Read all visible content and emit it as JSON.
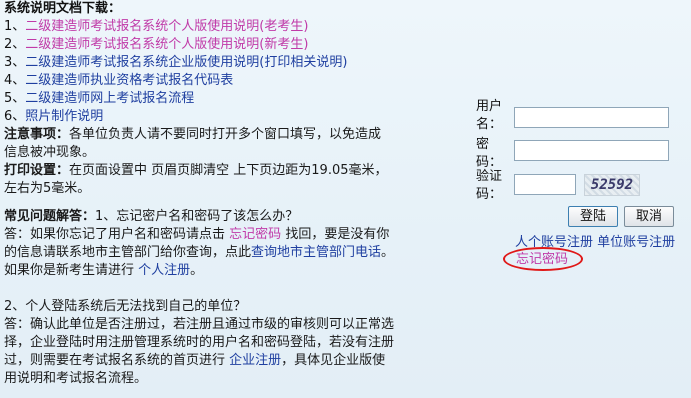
{
  "docs": {
    "heading": "系统说明文档下载：",
    "items": [
      {
        "num": "1、",
        "label": "二级建造师考试报名系统个人版使用说明(老考生)"
      },
      {
        "num": "2、",
        "label": "二级建造师考试报名系统个人版使用说明(新考生)"
      },
      {
        "num": "3、",
        "label": "二级建造师考试报名系统企业版使用说明(打印相关说明)"
      },
      {
        "num": "4、",
        "label": "二级建造师执业资格考试报名代码表"
      },
      {
        "num": "5、",
        "label": "二级建造师网上考试报名流程"
      },
      {
        "num": "6、",
        "label": "照片制作说明"
      }
    ]
  },
  "notice": {
    "title": "注意事项：",
    "text1": "各单位负责人请不要同时打开多个窗口填写，以免造成",
    "text2": "信息被冲现象。"
  },
  "print": {
    "title": "打印设置：",
    "text1": "在页面设置中 页眉页脚清空 上下页边距为19.05毫米，",
    "text2": "左右为5毫米。"
  },
  "faq": {
    "title": "常见问题解答：",
    "q1": "1、忘记密户名和密码了该怎么办？",
    "a1_prefix": "答：如果你忘记了用户名和密码请点击",
    "a1_link": "忘记密码",
    "a1_mid": "找回，要是没有你",
    "a1_line2_prefix": "的信息请联系地市主管部门给你查询，点此",
    "a1_link2": "查询地市主管部门电话",
    "a1_line2_end": "。",
    "a1_line3_prefix": "如果你是新考生请进行",
    "a1_link3": "个人注册",
    "a1_line3_end": "。",
    "q2": "2、个人登陆系统后无法找到自己的单位？",
    "a2_line1": "答：确认此单位是否注册过，若注册且通过市级的审核则可以正常选",
    "a2_line2": "择，企业登陆时用注册管理系统时的用户名和密码登陆，若没有注册",
    "a2_line3_prefix": "过，则需要在考试报名系统的首页进行",
    "a2_link": "企业注册",
    "a2_line3_end": "，具体见企业版使",
    "a2_line4": "用说明和考试报名流程。"
  },
  "login": {
    "username_label_1": "用户",
    "username_label_2": "名：",
    "username_value": "",
    "password_label_1": "密",
    "password_label_2": "码：",
    "password_value": "",
    "captcha_label_1": "验证",
    "captcha_label_2": "码：",
    "captcha_value": "",
    "captcha_image_text": "52592",
    "login_button": "登陆",
    "cancel_button": "取消",
    "personal_register": "人个账号注册",
    "unit_register": "单位账号注册",
    "forgot_password": "忘记密码"
  },
  "colors": {
    "link_pink": "#c03aa8",
    "link_blue": "#1f3fa0",
    "highlight_circle": "#e01818"
  }
}
